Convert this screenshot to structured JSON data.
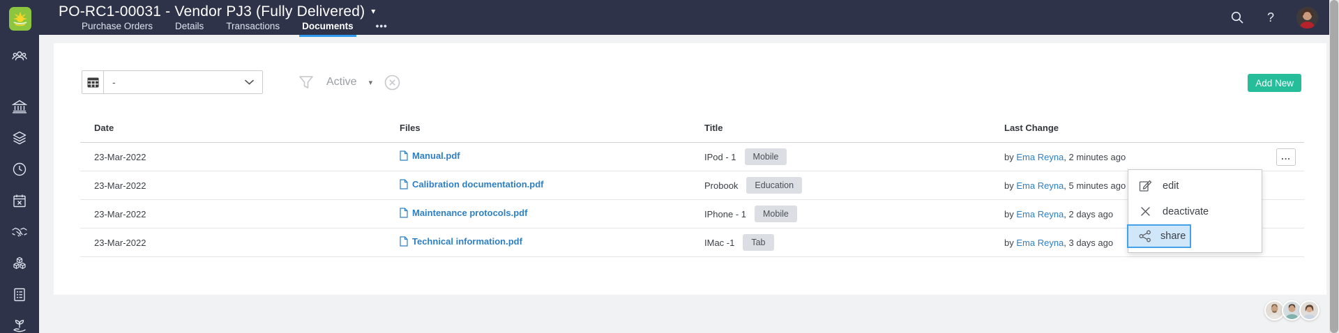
{
  "header": {
    "title": "PO-RC1-00031 - Vendor PJ3 (Fully Delivered)",
    "title_caret": "▾",
    "tabs": [
      {
        "label": "Purchase Orders",
        "active": false
      },
      {
        "label": "Details",
        "active": false
      },
      {
        "label": "Transactions",
        "active": false
      },
      {
        "label": "Documents",
        "active": true
      }
    ],
    "tabs_overflow": "•••",
    "help_glyph": "?"
  },
  "toolbar": {
    "view_selector_value": "-",
    "filter_status": "Active",
    "filter_caret": "▾",
    "add_new_label": "Add New"
  },
  "table": {
    "columns": {
      "date": "Date",
      "files": "Files",
      "title": "Title",
      "last_change": "Last Change"
    },
    "rows": [
      {
        "date": "23-Mar-2022",
        "file": "Manual.pdf",
        "title": "IPod - 1",
        "badge": "Mobile",
        "by": "by",
        "user": "Ema Reyna",
        "ago": ", 2 minutes ago",
        "actions": "..."
      },
      {
        "date": "23-Mar-2022",
        "file": "Calibration documentation.pdf",
        "title": "Probook",
        "badge": "Education",
        "by": "by",
        "user": "Ema Reyna",
        "ago": ", 5 minutes ago"
      },
      {
        "date": "23-Mar-2022",
        "file": "Maintenance protocols.pdf",
        "title": "IPhone - 1",
        "badge": "Mobile",
        "by": "by",
        "user": "Ema Reyna",
        "ago": ", 2 days ago"
      },
      {
        "date": "23-Mar-2022",
        "file": "Technical information.pdf",
        "title": "IMac -1",
        "badge": "Tab",
        "by": "by",
        "user": "Ema Reyna",
        "ago": ", 3 days ago"
      }
    ]
  },
  "context_menu": {
    "items": [
      {
        "label": "edit",
        "icon": "edit-icon",
        "highlighted": false
      },
      {
        "label": "deactivate",
        "icon": "close-icon",
        "highlighted": false
      },
      {
        "label": "share",
        "icon": "share-icon",
        "highlighted": true
      }
    ]
  },
  "sidebar_icons": [
    "users",
    "bank",
    "layers",
    "clock",
    "calendar",
    "partners",
    "products",
    "checklist",
    "growth"
  ],
  "colors": {
    "header_bg": "#2f3349",
    "sidebar_bg": "#2f3349",
    "accent_teal": "#26bd9b",
    "link_blue": "#2e7fc2",
    "tab_underline": "#2e9bf0",
    "menu_highlight_bg": "#cfe7f8",
    "menu_highlight_border": "#43a1ea",
    "badge_bg": "#dbdfe4",
    "logo_green": "#8cc63e"
  }
}
